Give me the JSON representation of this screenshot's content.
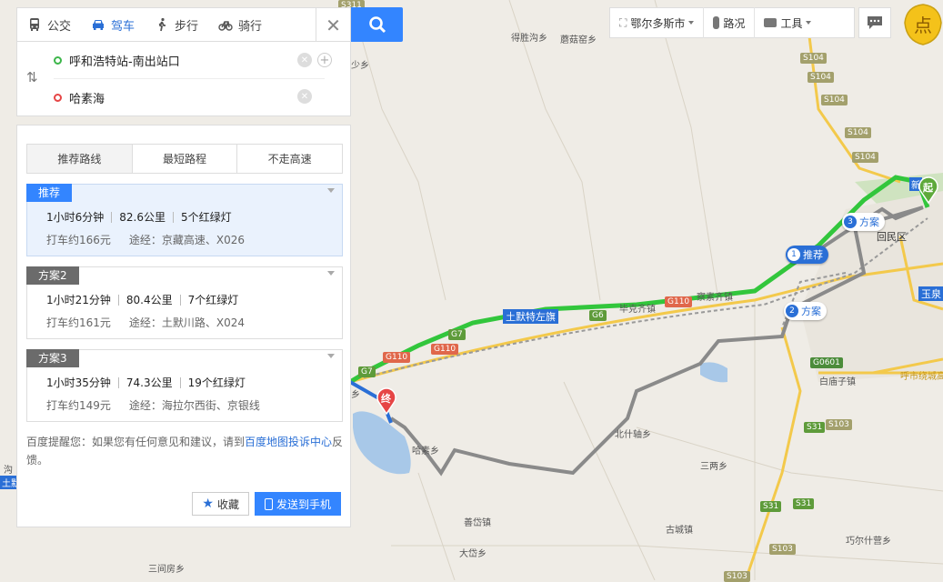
{
  "colors": {
    "accent": "#3385ff",
    "route": "#32c63c",
    "route_alt": "#8a8a8a",
    "start": "#3cb64a",
    "end": "#e64545"
  },
  "modes": [
    {
      "label": "公交",
      "icon": "bus-icon"
    },
    {
      "label": "驾车",
      "icon": "car-icon",
      "active": true
    },
    {
      "label": "步行",
      "icon": "walk-icon"
    },
    {
      "label": "骑行",
      "icon": "bike-icon"
    }
  ],
  "route": {
    "start": "呼和浩特站-南出站口",
    "end": "哈素海"
  },
  "tabs": [
    "推荐路线",
    "最短路程",
    "不走高速"
  ],
  "plans": [
    {
      "tag": "推荐",
      "time": "1小时6分钟",
      "distance": "82.6公里",
      "lights": "5个红绿灯",
      "taxi": "打车约166元",
      "via": "途经：京藏高速、X026"
    },
    {
      "tag": "方案2",
      "time": "1小时21分钟",
      "distance": "80.4公里",
      "lights": "7个红绿灯",
      "taxi": "打车约161元",
      "via": "途经：土默川路、X024"
    },
    {
      "tag": "方案3",
      "time": "1小时35分钟",
      "distance": "74.3公里",
      "lights": "19个红绿灯",
      "taxi": "打车约149元",
      "via": "途经：海拉尔西街、京银线"
    }
  ],
  "tip": {
    "prefix": "百度提醒您：如果您有任何意见和建议，请到",
    "link": "百度地图投诉中心",
    "suffix": "反馈。"
  },
  "buttons": {
    "favorite": "收藏",
    "send": "发送到手机"
  },
  "toolbar": {
    "city": "鄂尔多斯市",
    "traffic": "路况",
    "tools": "工具"
  },
  "map": {
    "places": [
      "得胜沟乡",
      "蘑菇窑乡",
      "回民区",
      "玉泉",
      "土默特左旗",
      "毕克齐镇",
      "察素齐镇",
      "白庙子镇",
      "北什轴乡",
      "三两乡",
      "哈素乡",
      "善岱镇",
      "古城镇",
      "巧尔什营乡",
      "大岱乡",
      "三间房乡",
      "呼市绕城高速",
      "沟",
      "土默",
      "乡",
      "少乡",
      "新"
    ],
    "shields": [
      "S311",
      "S104",
      "S104",
      "S104",
      "S104",
      "S104",
      "G110",
      "G6",
      "G7",
      "G110",
      "G110",
      "G7",
      "G0601",
      "S31",
      "S103",
      "S31",
      "S103",
      "S103",
      "S31"
    ],
    "markers": {
      "start": "起",
      "end": "终",
      "m1_num": "1",
      "m1": "推荐",
      "m2_num": "2",
      "m2": "方案",
      "m3_num": "3",
      "m3": "方案"
    }
  }
}
